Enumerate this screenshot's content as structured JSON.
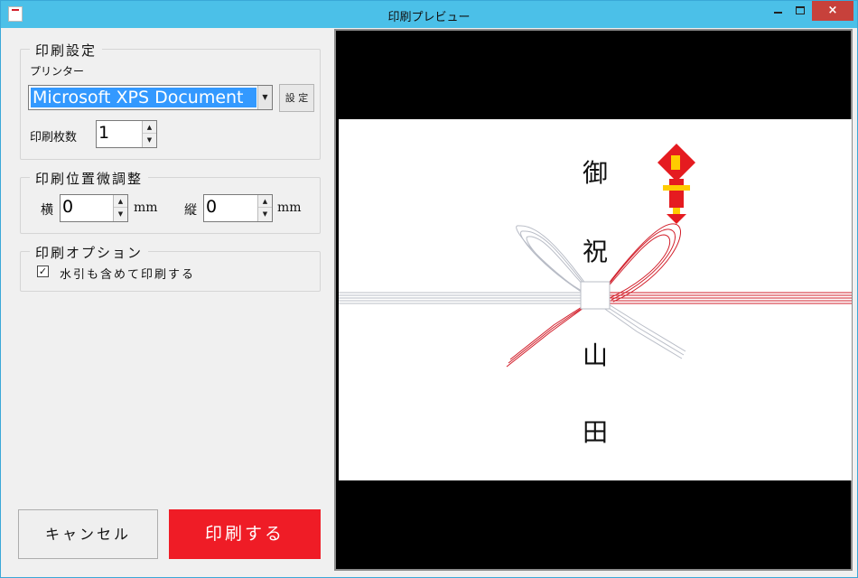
{
  "window": {
    "title": "印刷プレビュー"
  },
  "titlebar": {
    "minimize": "minimize",
    "maximize": "maximize",
    "close": "×"
  },
  "print_settings": {
    "title": "印刷設定",
    "printer_label": "プリンター",
    "printer_value": "Microsoft XPS Document",
    "settings_button": "設 定",
    "copies_label": "印刷枚数",
    "copies_value": "1"
  },
  "adjust": {
    "title": "印刷位置微調整",
    "horizontal_label": "横",
    "horizontal_value": "0",
    "horizontal_unit": "mm",
    "vertical_label": "縦",
    "vertical_value": "0",
    "vertical_unit": "mm"
  },
  "options": {
    "title": "印刷オプション",
    "watermark_label": "水引も含めて印刷する",
    "watermark_checked": true
  },
  "buttons": {
    "cancel": "キャンセル",
    "print": "印刷する"
  },
  "preview": {
    "text_top_1": "御",
    "text_top_2": "祝",
    "text_bottom_1": "山",
    "text_bottom_2": "田"
  },
  "colors": {
    "titlebar": "#4bc0e8",
    "close": "#c7413b",
    "print_button": "#ef1c26",
    "selection": "#3399ff",
    "mizuhiki_red": "#d21f2b",
    "mizuhiki_silver": "#b8bcc6"
  }
}
